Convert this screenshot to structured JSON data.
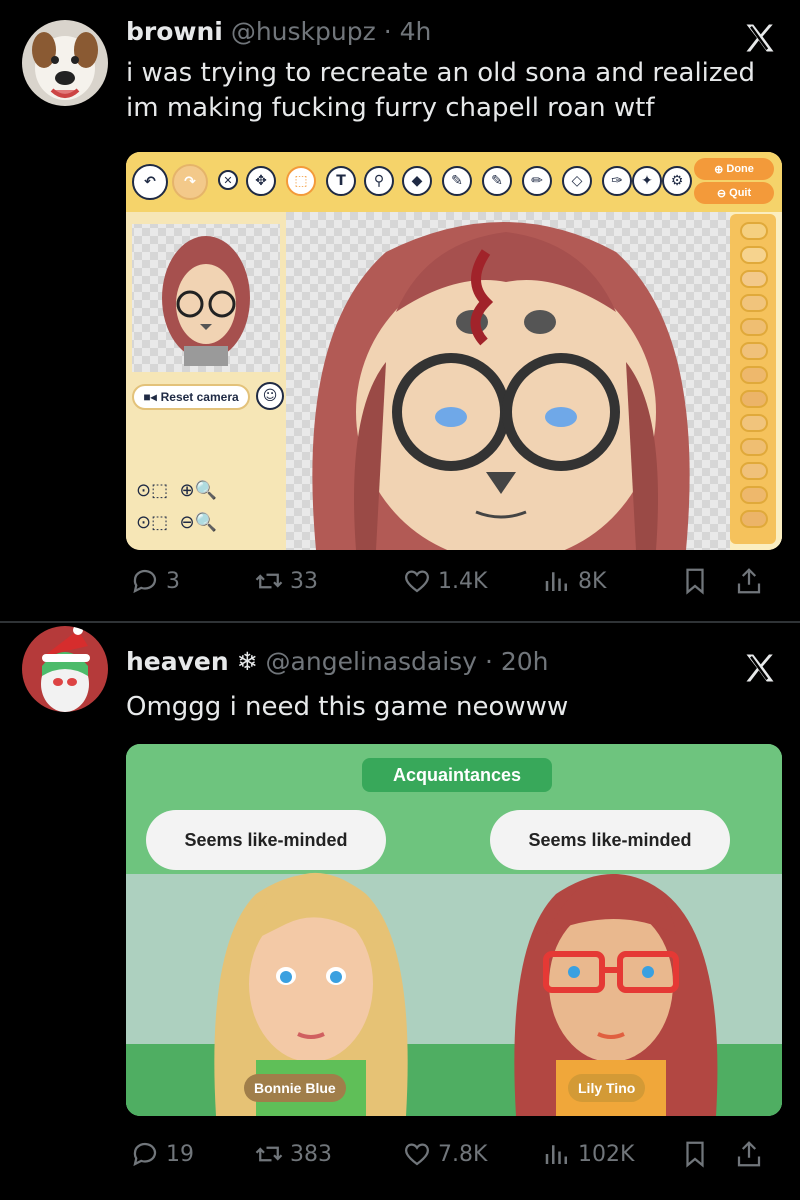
{
  "tweets": [
    {
      "name": "browni",
      "handle": "@huskpupz",
      "sep": "·",
      "time": "4h",
      "text": "i was trying to recreate an old sona and realized im making fucking furry chapell roan wtf",
      "media": {
        "tools": [
          "↶",
          "↷",
          "✕",
          "✥",
          "⬚",
          "T",
          "⚲",
          "◆",
          "✎",
          "✎",
          "✏",
          "◇",
          "✑",
          "✦",
          "⚙"
        ],
        "done_label": "Done",
        "quit_label": "Quit",
        "reset_camera_label": "Reset camera"
      },
      "stats": {
        "replies": "3",
        "reposts": "33",
        "likes": "1.4K",
        "views": "8K"
      }
    },
    {
      "name": "heaven",
      "emoji": "❄",
      "handle": "@angelinasdaisy",
      "sep": "·",
      "time": "20h",
      "text": "Omggg i need this game neowww",
      "media": {
        "tab_label": "Acquaintances",
        "bubble_left": "Seems like-minded",
        "bubble_right": "Seems like-minded",
        "name_left": "Bonnie Blue",
        "name_right": "Lily Tino"
      },
      "stats": {
        "replies": "19",
        "reposts": "383",
        "likes": "7.8K",
        "views": "102K"
      }
    }
  ],
  "colors": {
    "bg": "#000000",
    "text": "#e7e9ea",
    "muted": "#71767b"
  }
}
